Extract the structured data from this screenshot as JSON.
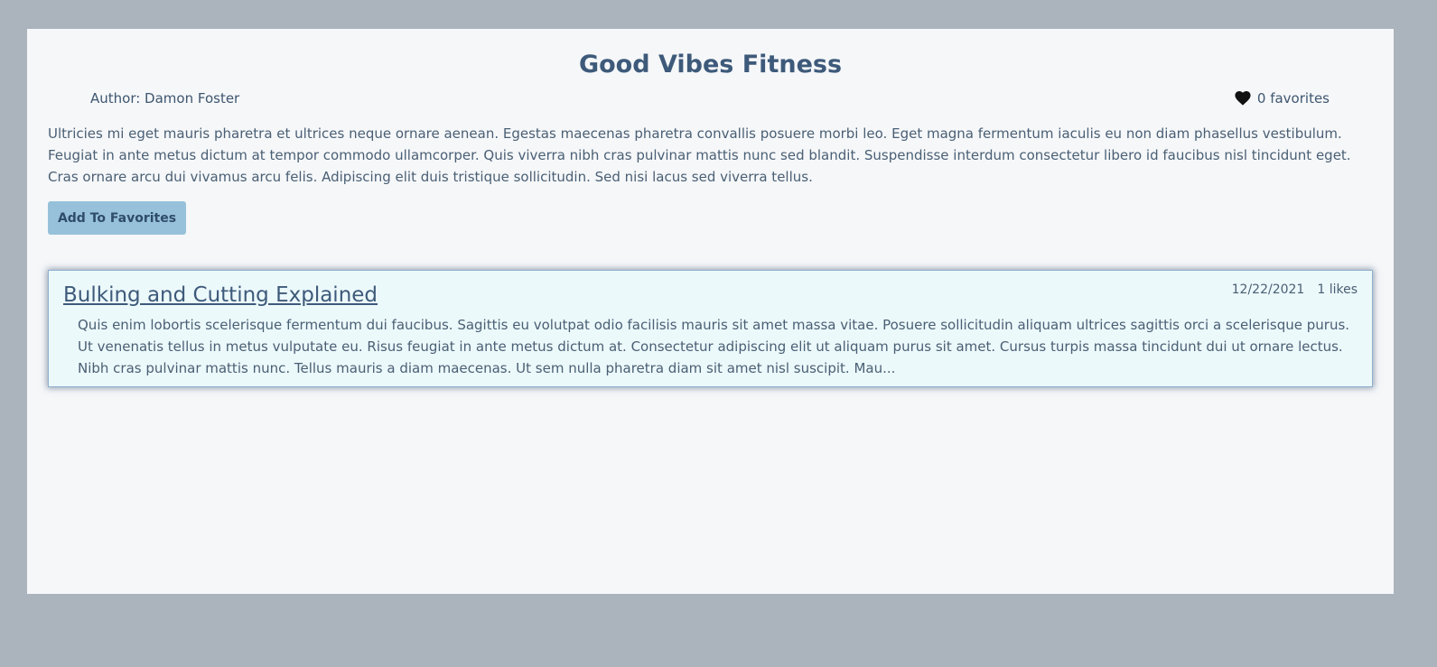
{
  "blog": {
    "title": "Good Vibes Fitness",
    "author": "Author: Damon Foster",
    "favorites_count": "0 favorites",
    "description": "Ultricies mi eget mauris pharetra et ultrices neque ornare aenean. Egestas maecenas pharetra convallis posuere morbi leo. Eget magna fermentum iaculis eu non diam phasellus vestibulum. Feugiat in ante metus dictum at tempor commodo ullamcorper. Quis viverra nibh cras pulvinar mattis nunc sed blandit. Suspendisse interdum consectetur libero id faucibus nisl tincidunt eget. Cras ornare arcu dui vivamus arcu felis. Adipiscing elit duis tristique sollicitudin. Sed nisi lacus sed viverra tellus.",
    "add_favorite_label": "Add To Favorites",
    "heart_icon": "heart-icon"
  },
  "posts": [
    {
      "title": "Bulking and Cutting Explained",
      "date": "12/22/2021",
      "likes": "1 likes",
      "excerpt": "Quis enim lobortis scelerisque fermentum dui faucibus. Sagittis eu volutpat odio facilisis mauris sit amet massa vitae. Posuere sollicitudin aliquam ultrices sagittis orci a scelerisque purus. Ut venenatis tellus in metus vulputate eu. Risus feugiat in ante metus dictum at. Consectetur adipiscing elit ut aliquam purus sit amet. Cursus turpis massa tincidunt dui ut ornare lectus. Nibh cras pulvinar mattis nunc. Tellus mauris a diam maecenas. Ut sem nulla pharetra diam sit amet nisl suscipit. Mau..."
    }
  ],
  "colors": {
    "page_background": "#abb4bd",
    "panel_background": "#f5f7f9",
    "heading": "#3e5a7a",
    "button": "#97c1da",
    "card_background": "#ecf9fb"
  }
}
